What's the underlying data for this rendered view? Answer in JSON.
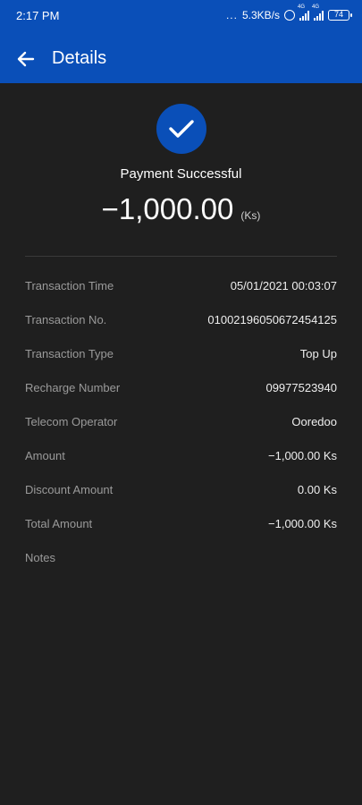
{
  "status_bar": {
    "time": "2:17 PM",
    "dots": "...",
    "speed": "5.3KB/s",
    "sim1_label": "4G",
    "sim2_label": "4G",
    "battery": "74"
  },
  "header": {
    "back_icon": "arrow-left-icon",
    "title": "Details",
    "color": "#0a4fb8"
  },
  "summary": {
    "status_text": "Payment Successful",
    "amount": "−1,000.00",
    "currency": "(Ks)"
  },
  "details": {
    "rows": [
      {
        "label": "Transaction Time",
        "value": "05/01/2021 00:03:07"
      },
      {
        "label": "Transaction No.",
        "value": "01002196050672454125"
      },
      {
        "label": "Transaction Type",
        "value": "Top Up"
      },
      {
        "label": "Recharge Number",
        "value": "09977523940"
      },
      {
        "label": "Telecom Operator",
        "value": "Ooredoo"
      },
      {
        "label": "Amount",
        "value": "−1,000.00 Ks"
      },
      {
        "label": "Discount Amount",
        "value": "0.00 Ks"
      },
      {
        "label": "Total Amount",
        "value": "−1,000.00 Ks"
      },
      {
        "label": "Notes",
        "value": ""
      }
    ]
  }
}
